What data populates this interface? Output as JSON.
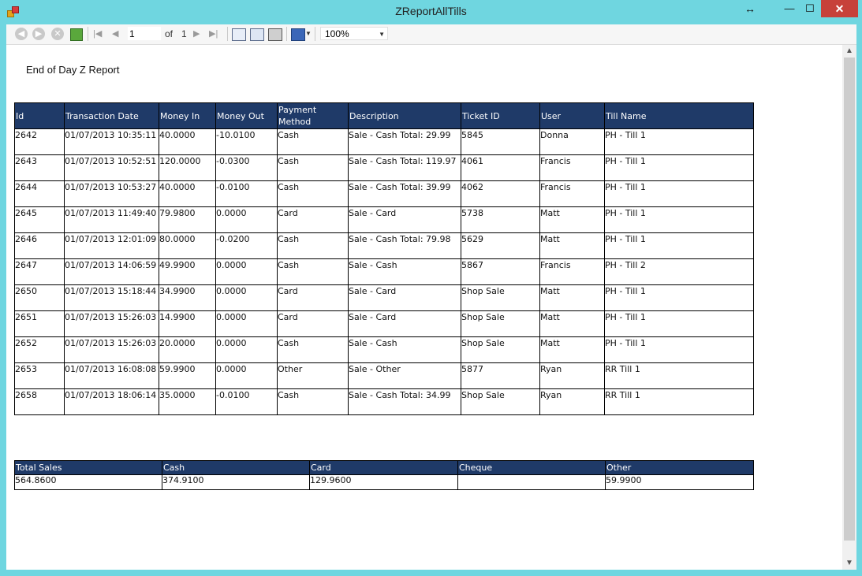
{
  "window": {
    "title": "ZReportAllTills"
  },
  "toolbar": {
    "page_value": "1",
    "of_label": "of",
    "total_pages": "1",
    "zoom": "100%"
  },
  "report": {
    "title": "End of Day Z Report",
    "columns": [
      "Id",
      "Transaction Date",
      "Money In",
      "Money Out",
      "Payment Method",
      "Description",
      "Ticket ID",
      "User",
      "Till Name"
    ],
    "rows": [
      [
        "2642",
        "01/07/2013 10:35:11",
        "40.0000",
        "-10.0100",
        "Cash",
        "Sale - Cash Total: 29.99",
        "5845",
        "Donna",
        "PH - Till 1"
      ],
      [
        "2643",
        "01/07/2013 10:52:51",
        "120.0000",
        "-0.0300",
        "Cash",
        "Sale - Cash Total: 119.97",
        "4061",
        "Francis",
        "PH - Till 1"
      ],
      [
        "2644",
        "01/07/2013 10:53:27",
        "40.0000",
        "-0.0100",
        "Cash",
        "Sale - Cash Total: 39.99",
        "4062",
        "Francis",
        "PH - Till 1"
      ],
      [
        "2645",
        "01/07/2013 11:49:40",
        "79.9800",
        "0.0000",
        "Card",
        "Sale - Card",
        "5738",
        "Matt",
        "PH - Till 1"
      ],
      [
        "2646",
        "01/07/2013 12:01:09",
        "80.0000",
        "-0.0200",
        "Cash",
        "Sale - Cash Total: 79.98",
        "5629",
        "Matt",
        "PH - Till 1"
      ],
      [
        "2647",
        "01/07/2013 14:06:59",
        "49.9900",
        "0.0000",
        "Cash",
        "Sale - Cash",
        "5867",
        "Francis",
        "PH - Till 2"
      ],
      [
        "2650",
        "01/07/2013 15:18:44",
        "34.9900",
        "0.0000",
        "Card",
        "Sale - Card",
        "Shop Sale",
        "Matt",
        "PH - Till 1"
      ],
      [
        "2651",
        "01/07/2013 15:26:03",
        "14.9900",
        "0.0000",
        "Card",
        "Sale - Card",
        "Shop Sale",
        "Matt",
        "PH - Till 1"
      ],
      [
        "2652",
        "01/07/2013 15:26:03",
        "20.0000",
        "0.0000",
        "Cash",
        "Sale - Cash",
        "Shop Sale",
        "Matt",
        "PH - Till 1"
      ],
      [
        "2653",
        "01/07/2013 16:08:08",
        "59.9900",
        "0.0000",
        "Other",
        "Sale - Other",
        "5877",
        "Ryan",
        "RR Till 1"
      ],
      [
        "2658",
        "01/07/2013 18:06:14",
        "35.0000",
        "-0.0100",
        "Cash",
        "Sale - Cash Total: 34.99",
        "Shop Sale",
        "Ryan",
        "RR Till 1"
      ]
    ],
    "totals": {
      "columns": [
        "Total Sales",
        "Cash",
        "Card",
        "Cheque",
        "Other"
      ],
      "values": [
        "564.8600",
        "374.9100",
        "129.9600",
        "",
        "59.9900"
      ]
    }
  }
}
